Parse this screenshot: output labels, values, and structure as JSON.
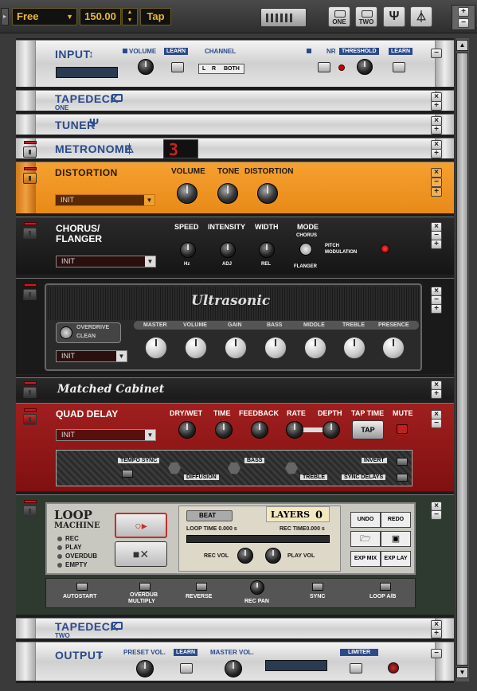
{
  "topbar": {
    "mode": "Free",
    "tempo": "150.00",
    "tap": "Tap",
    "one": "ONE",
    "two": "TWO"
  },
  "input": {
    "title": "INPUT",
    "volume": "VOLUME",
    "learn": "LEARN",
    "channel": "CHANNEL",
    "l": "L",
    "r": "R",
    "both": "BOTH",
    "nr": "NR",
    "threshold": "THRESHOLD",
    "learn2": "LEARN"
  },
  "tapedeck1": {
    "title": "TAPEDECK",
    "sub": "ONE"
  },
  "tuner": {
    "title": "TUNER"
  },
  "metronome": {
    "title": "METRONOME",
    "count": "3"
  },
  "distortion": {
    "title": "DISTORTION",
    "preset": "INIT",
    "volume": "VOLUME",
    "tone": "TONE",
    "distortion": "DISTORTION"
  },
  "chorus": {
    "title1": "CHORUS/",
    "title2": "FLANGER",
    "preset": "INIT",
    "speed": "SPEED",
    "intensity": "INTENSITY",
    "width": "WIDTH",
    "mode": "MODE",
    "chorus": "CHORUS",
    "flanger": "FLANGER",
    "pitch": "PITCH",
    "modulation": "MODULATION",
    "hz": "Hz",
    "adj": "ADJ",
    "rel": "REL"
  },
  "amp": {
    "brand": "Ultrasonic",
    "overdrive": "OVERDRIVE",
    "clean": "CLEAN",
    "preset": "INIT",
    "knobs": [
      "MASTER",
      "VOLUME",
      "GAIN",
      "BASS",
      "MIDDLE",
      "TREBLE",
      "PRESENCE"
    ]
  },
  "cabinet": {
    "title": "Matched Cabinet"
  },
  "delay": {
    "title": "QUAD DELAY",
    "preset": "INIT",
    "drywet": "DRY/WET",
    "time": "TIME",
    "feedback": "FEEDBACK",
    "rate": "RATE",
    "depth": "DEPTH",
    "taptime": "TAP TIME",
    "mute": "MUTE",
    "tap": "TAP",
    "temposync": "TEMPO SYNC",
    "diffusion": "DIFFUSION",
    "bass": "BASS",
    "treble": "TREBLE",
    "invert": "INVERT",
    "syncdelays": "SYNC DELAYS"
  },
  "loop": {
    "t1": "LOOP",
    "t2": "MACHINE",
    "rec": "REC",
    "play": "PLAY",
    "overdub": "OVERDUB",
    "empty": "EMPTY",
    "beat": "BEAT",
    "layers": "LAYERS",
    "layers_n": "0",
    "looptime": "LOOP TIME 0.000 s",
    "rectime": "REC TIME0.000 s",
    "recvol": "REC VOL",
    "playvol": "PLAY VOL",
    "undo": "UNDO",
    "redo": "REDO",
    "expmix": "EXP MIX",
    "explay": "EXP LAY",
    "autostart": "AUTOSTART",
    "overdub2": "OVERDUB",
    "multiply": "MULTIPLY",
    "reverse": "REVERSE",
    "recpan": "REC PAN",
    "sync": "SYNC",
    "loopab": "LOOP A/B"
  },
  "tapedeck2": {
    "title": "TAPEDECK",
    "sub": "TWO"
  },
  "output": {
    "title": "OUTPUT",
    "presetvol": "PRESET VOL.",
    "learn": "LEARN",
    "mastervol": "MASTER VOL.",
    "limiter": "LIMITER"
  }
}
